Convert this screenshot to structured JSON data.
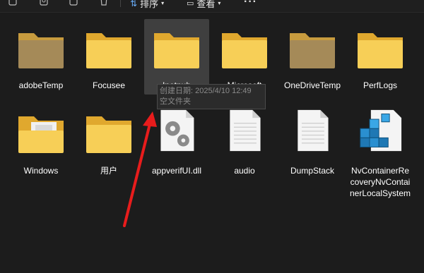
{
  "toolbar": {
    "sort_label": "排序",
    "view_label": "查看",
    "more_label": "···",
    "icons": [
      "copy-icon",
      "paste-icon",
      "share-icon",
      "delete-icon",
      "sort-icon",
      "view-icon"
    ]
  },
  "items": [
    {
      "name": "adobeTemp",
      "type": "folder"
    },
    {
      "name": "Focusee",
      "type": "folder"
    },
    {
      "name": "Inetpub",
      "type": "folder"
    },
    {
      "name": "Microsoft",
      "type": "folder"
    },
    {
      "name": "OneDriveTemp",
      "type": "folder"
    },
    {
      "name": "PerfLogs",
      "type": "folder"
    },
    {
      "name": "Windows",
      "type": "folder"
    },
    {
      "name": "用户",
      "type": "folder"
    },
    {
      "name": "appverifUI.dll",
      "type": "dll"
    },
    {
      "name": "audio",
      "type": "file"
    },
    {
      "name": "DumpStack",
      "type": "file"
    },
    {
      "name": "NvContainerRecoveryNvContainerLocalSystem",
      "type": "app"
    }
  ],
  "tooltip": {
    "line1": "创建日期: 2025/4/10 12:49",
    "line2": "空文件夹"
  },
  "colors": {
    "background": "#1c1c1c",
    "folder": "#f5c84c",
    "folder_back": "#e0a82e",
    "arrow": "#e81c1c"
  }
}
